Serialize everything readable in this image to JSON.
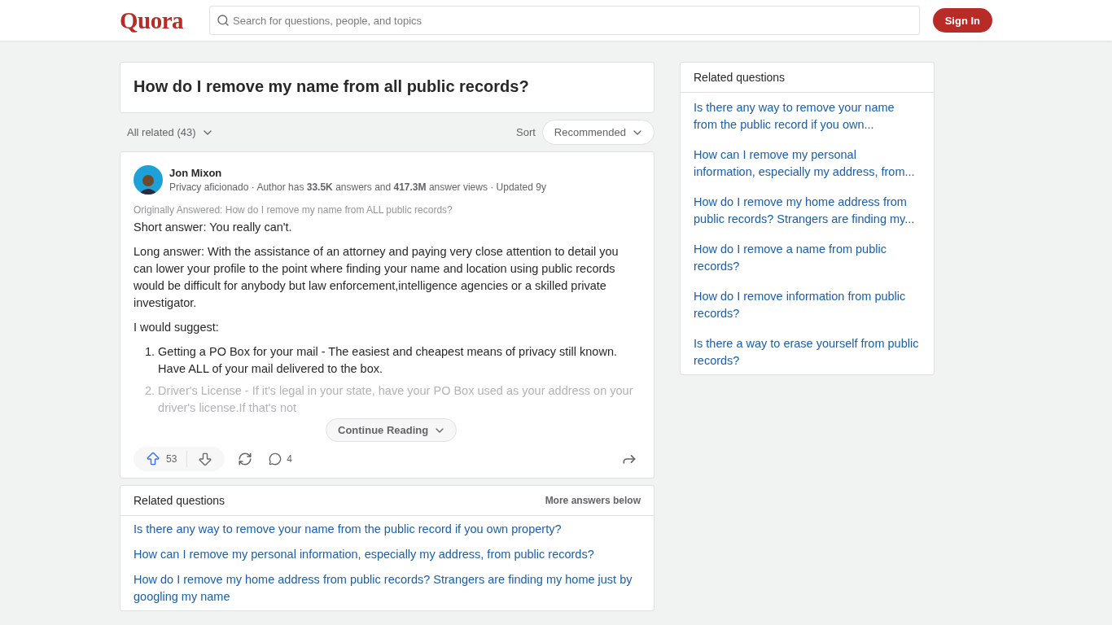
{
  "header": {
    "logo": "Quora",
    "search": {
      "placeholder": "Search for questions, people, and topics"
    },
    "sign_in": "Sign In"
  },
  "question": {
    "title": "How do I remove my name from all public records?"
  },
  "filter": {
    "label": "All related (43)",
    "sort_label": "Sort",
    "sort_value": "Recommended"
  },
  "answer": {
    "author": "Jon Mixon",
    "meta": "Privacy aficionado · Author has **33.5K** answers and **417.3M** answer views · Updated 9y",
    "originally": "Originally Answered: How do I remove my name from ALL public records?",
    "paragraphs": [
      "Short answer: You really can't.",
      "Long answer: With the assistance of an attorney and paying very close attention to detail you can lower your profile to the point where finding your name and location using public records would be difficult for anybody but law enforcement,intelligence agencies or a skilled private investigator.",
      "I would suggest:"
    ],
    "list": [
      {
        "number": "1.",
        "text": "Getting a PO Box for your mail - The easiest and cheapest means of privacy still known. Have ALL of your mail delivered to the box.",
        "faded": false
      },
      {
        "number": "2.",
        "text": "Driver's License - If it's legal in your state, have your PO Box used as your address on your driver's license.If that's not",
        "faded": true
      }
    ],
    "continue": "Continue Reading",
    "upvotes": "53",
    "comments": "4"
  },
  "related_inline": {
    "title": "Related questions",
    "note": "More answers below",
    "items": [
      "Is there any way to remove your name from the public record if you own property?",
      "How can I remove my personal information, especially my address, from public records?",
      "How do I remove my home address from public records? Strangers are finding my home just by googling my name"
    ]
  },
  "related_sidebar": {
    "title": "Related questions",
    "items": [
      "Is there any way to remove your name from the public record if you own...",
      "How can I remove my personal information, especially my address, from...",
      "How do I remove my home address from public records? Strangers are finding my...",
      "How do I remove a name from public records?",
      "How do I remove information from public records?",
      "Is there a way to erase yourself from public records?"
    ]
  }
}
